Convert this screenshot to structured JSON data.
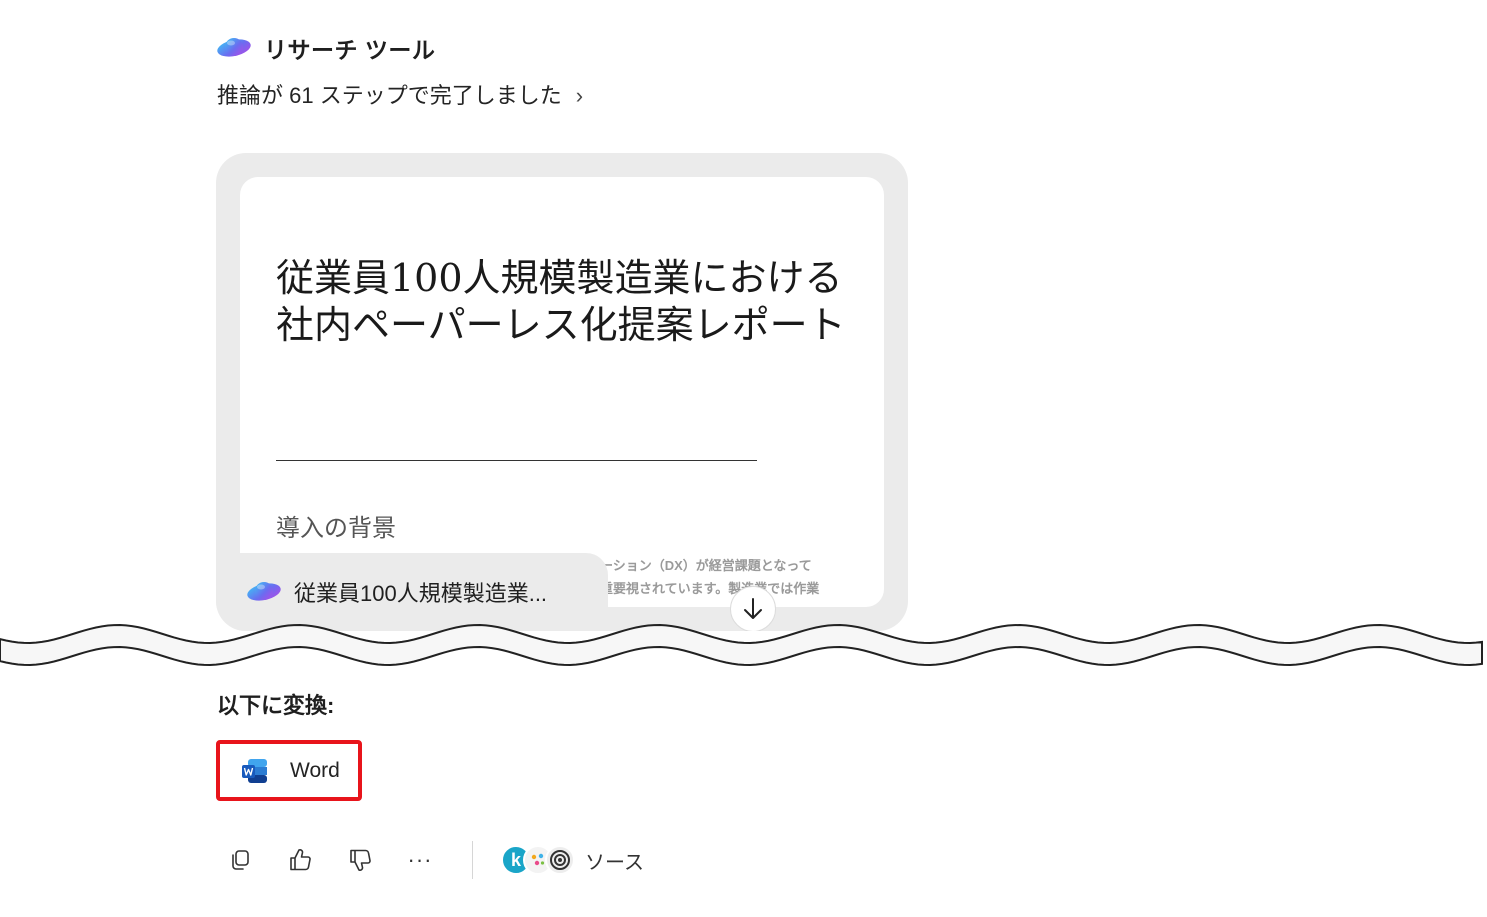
{
  "header": {
    "tool_title": "リサーチ ツール",
    "steps_text": "推論が 61 ステップで完了しました",
    "chevron_glyph": "›"
  },
  "document": {
    "title": "従業員100人規模製造業における社内ペーパーレス化提案レポート",
    "section_heading": "導入の背景",
    "body_line1": "ーション（DX）が経営課題となって",
    "body_line2": "重要視されています。製造業では作業",
    "file_name": "従業員100人規模製造業..."
  },
  "convert": {
    "label": "以下に変換:",
    "word_label": "Word"
  },
  "actions": {
    "more_glyph": "···",
    "sources_label": "ソース",
    "source_avatar_1": "k"
  },
  "colors": {
    "highlight_border": "#e8141b",
    "card_bg": "#ebebeb",
    "word_blue": "#185abd"
  }
}
